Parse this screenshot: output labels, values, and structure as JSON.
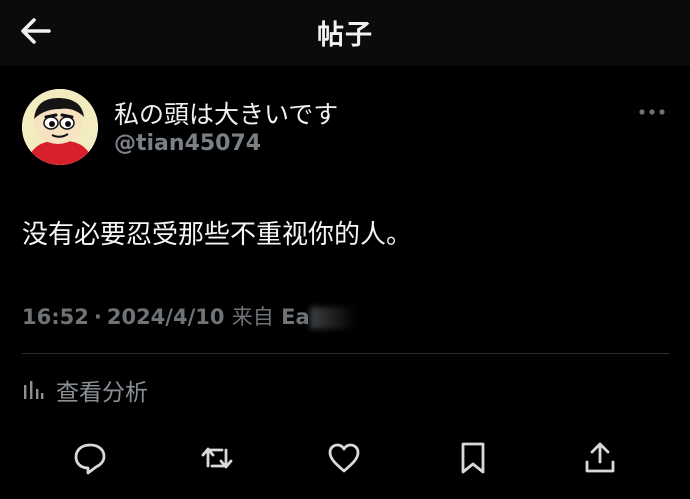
{
  "header": {
    "title": "帖子"
  },
  "post": {
    "display_name": "私の頭は大きいです",
    "handle": "@tian45074",
    "text": "没有必要忍受那些不重视你的人。",
    "time": "16:52",
    "separator": "·",
    "date": "2024/4/10",
    "source_prefix": "来自",
    "source_visible": "Ea"
  },
  "analytics": {
    "label": "查看分析"
  },
  "actions": [
    "reply-icon",
    "repost-icon",
    "like-icon",
    "bookmark-icon",
    "share-icon"
  ],
  "colors": {
    "background": "#000000",
    "header": "#0b0b0c",
    "text": "#f5f5f5",
    "muted": "#6e7378"
  }
}
